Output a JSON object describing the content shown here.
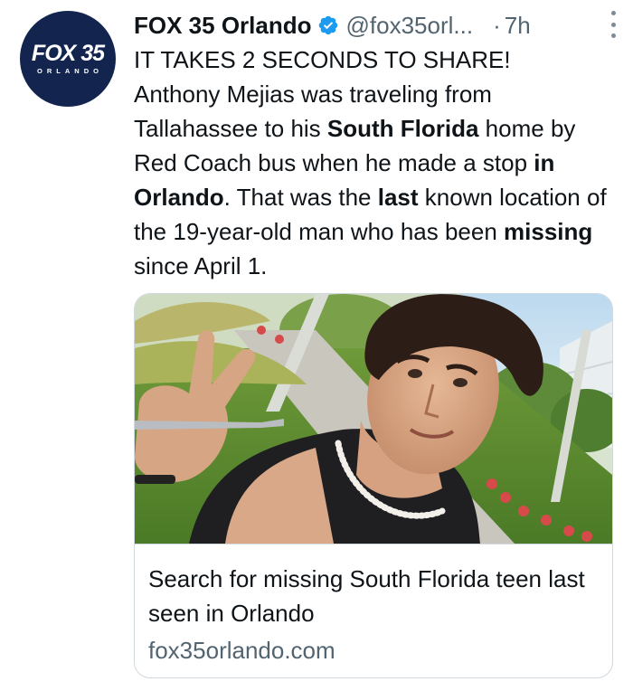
{
  "author": {
    "display_name": "FOX 35 Orlando",
    "handle": "@fox35orl...",
    "separator": "·",
    "time": "7h",
    "avatar_logo": "FOX 35",
    "avatar_subtext": "ORLANDO",
    "verified_icon": "verified-badge-icon",
    "brand_color": "#13254f",
    "verified_color": "#1d9bf0"
  },
  "menu": {
    "icon": "more-vertical-icon"
  },
  "tweet": {
    "line1": "IT TAKES 2 SECONDS TO SHARE!",
    "seg1": "Anthony Mejias was traveling from Tallahassee to his ",
    "seg2_bold": "South Florida",
    "seg3": " home by Red Coach bus when he made a stop ",
    "seg4_bold": "in Orlando",
    "seg5": ".  That was the ",
    "seg6_bold": "last",
    "seg7": " known location of the 19-year-old man who has been ",
    "seg8_bold": "missing",
    "seg9": " since April 1."
  },
  "card": {
    "title": "Search for missing South Florida teen last seen in Orlando",
    "domain": "fox35orlando.com"
  }
}
